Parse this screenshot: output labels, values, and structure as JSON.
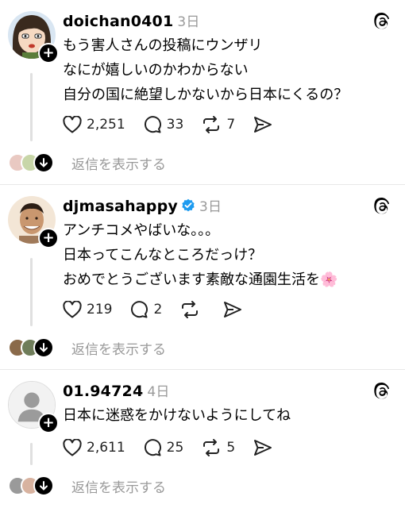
{
  "posts": [
    {
      "username": "doichan0401",
      "time": "3日",
      "verified": false,
      "avatar": "cartoon-avatar",
      "lines": [
        "もう害人さんの投稿にウンザリ",
        "なにが嬉しいのかわからない",
        "自分の国に絶望しかないから日本にくるの？"
      ],
      "likes": "2,251",
      "comments": "33",
      "reposts": "7",
      "reply_label": "返信を表示する"
    },
    {
      "username": "djmasahappy",
      "time": "3日",
      "verified": true,
      "avatar": "photo-avatar",
      "lines": [
        "アンチコメやばいな。。。",
        "日本ってこんなところだっけ？",
        "おめでとうございます素敵な通園生活を🌸"
      ],
      "likes": "219",
      "comments": "2",
      "reposts": "",
      "reply_label": "返信を表示する"
    },
    {
      "username": "01.94724",
      "time": "4日",
      "verified": false,
      "avatar": "default-avatar",
      "lines": [
        "日本に迷惑をかけないようにしてね"
      ],
      "likes": "2,611",
      "comments": "25",
      "reposts": "5",
      "reply_label": "返信を表示する"
    }
  ]
}
